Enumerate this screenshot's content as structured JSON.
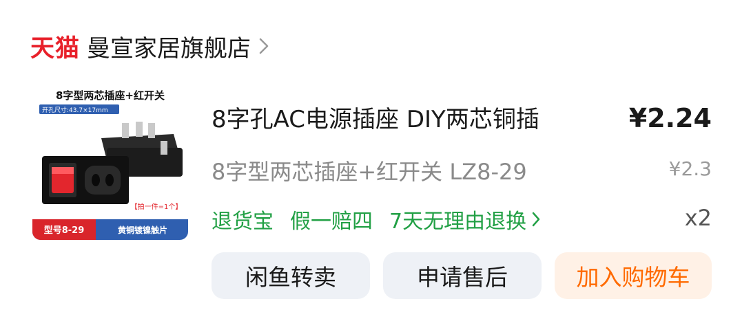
{
  "shop": {
    "platform": "天猫",
    "name": "曼宣家居旗舰店"
  },
  "product": {
    "title": "8字孔AC电源插座 DIY两芯铜插",
    "variant": "8字型两芯插座+红开关 LZ8-29",
    "price": "¥2.24",
    "original_price": "¥2.3",
    "quantity": "x2",
    "image": {
      "heading": "8字型两芯插座+红开关",
      "size_label": "开孔尺寸:43.7×17mm",
      "note": "【拍一件=1个】",
      "model": "型号8-29",
      "material": "黄铜镀镍触片"
    }
  },
  "services": [
    "退货宝",
    "假一赔四",
    "7天无理由退换"
  ],
  "buttons": {
    "resell": "闲鱼转卖",
    "aftersale": "申请售后",
    "add_to_cart": "加入购物车"
  },
  "colors": {
    "brand_red": "#e8202a",
    "service_green": "#22a045",
    "cart_orange": "#ff6a00",
    "cart_bg": "#fff1e6",
    "button_bg": "#eef1f6"
  },
  "icons": {
    "shop_chevron": "chevron-right-icon",
    "service_chevron": "chevron-right-icon"
  }
}
